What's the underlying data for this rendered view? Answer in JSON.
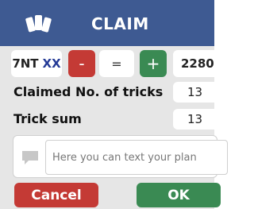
{
  "header": {
    "title": "CLAIM",
    "icon": "cards-icon"
  },
  "contract": {
    "level_suit": "7NT",
    "modifier": "XX"
  },
  "controls": {
    "minus_label": "-",
    "equals_label": "=",
    "plus_label": "+",
    "score": "2280"
  },
  "rows": [
    {
      "label": "Claimed No. of tricks",
      "value": "13"
    },
    {
      "label": "Trick sum",
      "value": "13"
    }
  ],
  "plan": {
    "icon": "chat-bubble-icon",
    "placeholder": "Here you can text your plan"
  },
  "buttons": {
    "cancel_label": "Cancel",
    "ok_label": "OK"
  },
  "colors": {
    "header_bg": "#3e5a92",
    "cancel": "#c43a35",
    "ok": "#3a8a53",
    "modifier_text": "#243a96"
  }
}
